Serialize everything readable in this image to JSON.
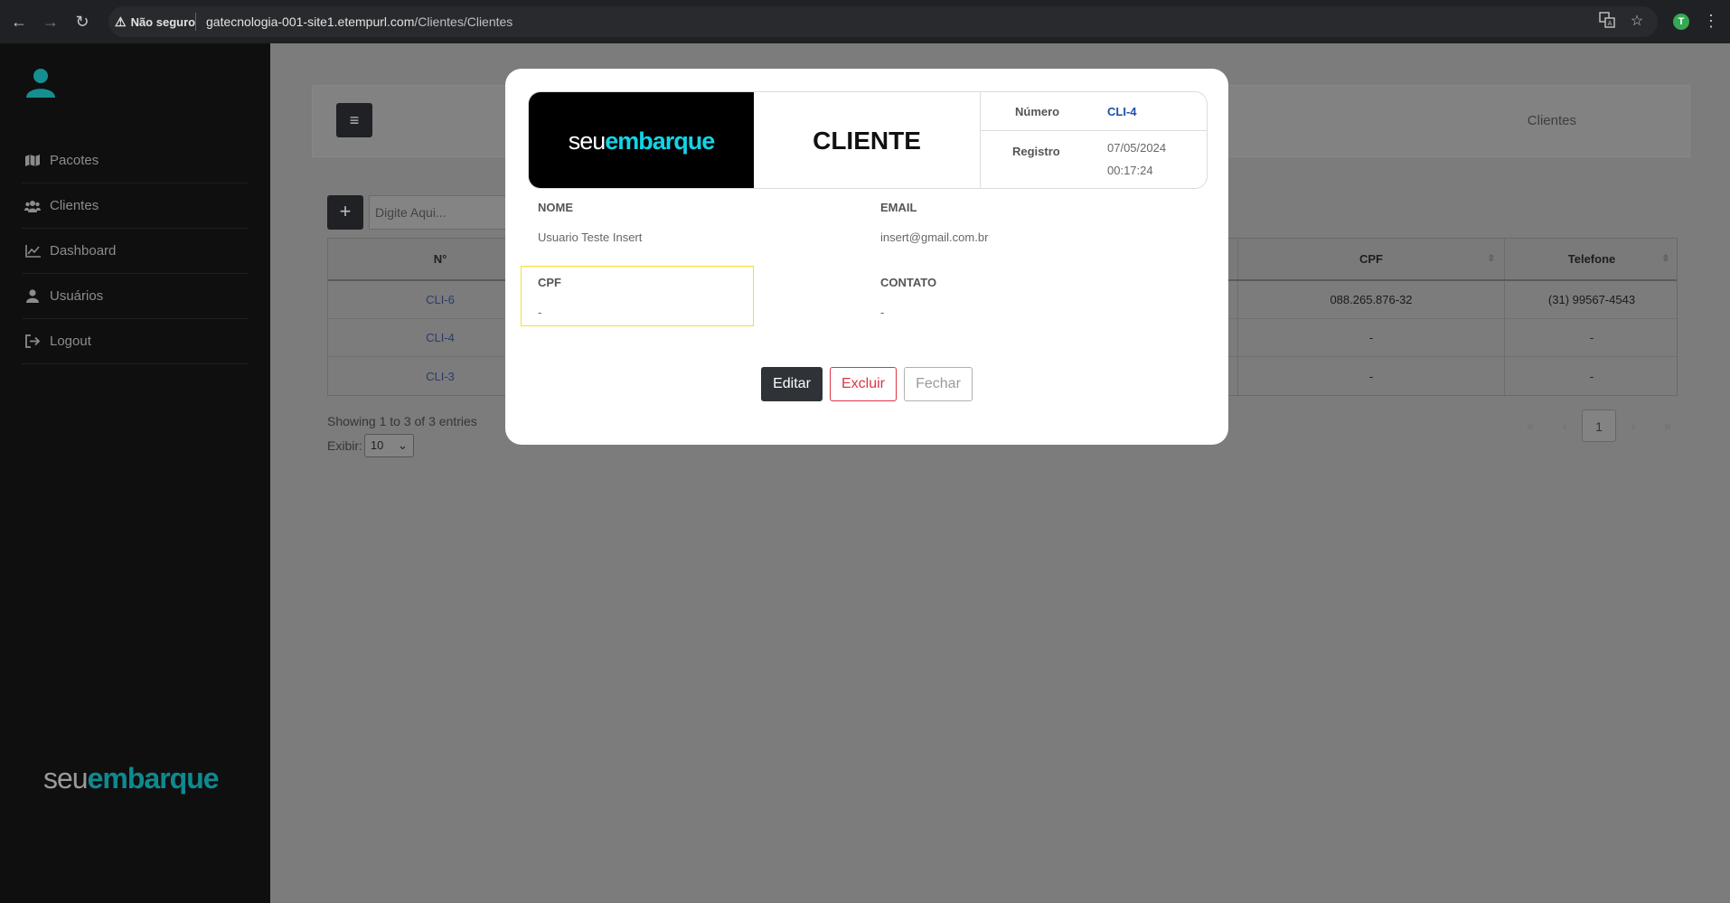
{
  "browser": {
    "security_label": "Não seguro",
    "url_host": "gatecnologia-001-site1.etempurl.com",
    "url_path": "/Clientes/Clientes",
    "profile_initial": "T"
  },
  "sidebar": {
    "items": [
      {
        "label": "Pacotes",
        "icon": "map-icon"
      },
      {
        "label": "Clientes",
        "icon": "users-icon"
      },
      {
        "label": "Dashboard",
        "icon": "chart-icon"
      },
      {
        "label": "Usuários",
        "icon": "user-icon"
      },
      {
        "label": "Logout",
        "icon": "logout-icon"
      }
    ],
    "brand_seu": "seu",
    "brand_embarque": "embarque"
  },
  "page": {
    "breadcrumb": "Clientes",
    "search_placeholder": "Digite Aqui...",
    "table": {
      "headers": [
        "N°",
        "",
        "CPF",
        "Telefone"
      ],
      "rows": [
        [
          "CLI-6",
          "",
          "088.265.876-32",
          "(31) 99567-4543"
        ],
        [
          "CLI-4",
          "",
          "-",
          "-"
        ],
        [
          "CLI-3",
          "",
          "-",
          "-"
        ]
      ]
    },
    "showing": "Showing 1 to 3 of 3 entries",
    "exibir_label": "Exibir:",
    "exibir_value": "10",
    "pager": {
      "first": "«",
      "prev": "‹",
      "current": "1",
      "next": "›",
      "last": "»"
    }
  },
  "modal": {
    "logo_seu": "seu",
    "logo_embarque": "embarque",
    "title": "CLIENTE",
    "numero_label": "Número",
    "numero_value": "CLI-4",
    "registro_label": "Registro",
    "registro_date": "07/05/2024",
    "registro_time": "00:17:24",
    "fields": {
      "nome_label": "NOME",
      "nome_value": "Usuario Teste Insert",
      "email_label": "EMAIL",
      "email_value": "insert@gmail.com.br",
      "cpf_label": "CPF",
      "cpf_value": "-",
      "contato_label": "CONTATO",
      "contato_value": "-"
    },
    "buttons": {
      "editar": "Editar",
      "excluir": "Excluir",
      "fechar": "Fechar"
    }
  },
  "colors": {
    "brand_cyan": "#13d4e8",
    "brand_teal": "#0e8a8f",
    "danger": "#dc3545",
    "highlight": "#f7df2a"
  }
}
